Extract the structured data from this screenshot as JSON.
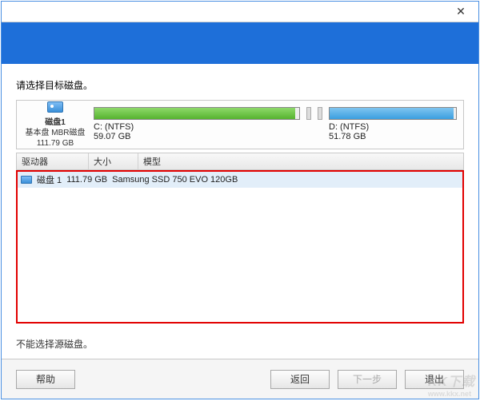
{
  "titlebar": {
    "close": "✕"
  },
  "prompt": "请选择目标磁盘。",
  "disk": {
    "label": "磁盘1",
    "type": "基本盘 MBR磁盘",
    "size": "111.79 GB"
  },
  "partitions": {
    "c": {
      "name": "C: (NTFS)",
      "size": "59.07 GB",
      "used_pct": 98
    },
    "d": {
      "name": "D: (NTFS)",
      "size": "51.78 GB",
      "used_pct": 98
    }
  },
  "columns": {
    "drive": "驱动器",
    "size": "大小",
    "model": "模型"
  },
  "rows": [
    {
      "drive": "磁盘 1",
      "size": "111.79 GB",
      "model": "Samsung SSD 750 EVO 120GB"
    }
  ],
  "note": "不能选择源磁盘。",
  "buttons": {
    "help": "帮助",
    "back": "返回",
    "next": "下一步",
    "exit": "退出"
  },
  "watermark": {
    "big": "KK下载",
    "small": "www.kkx.net"
  }
}
